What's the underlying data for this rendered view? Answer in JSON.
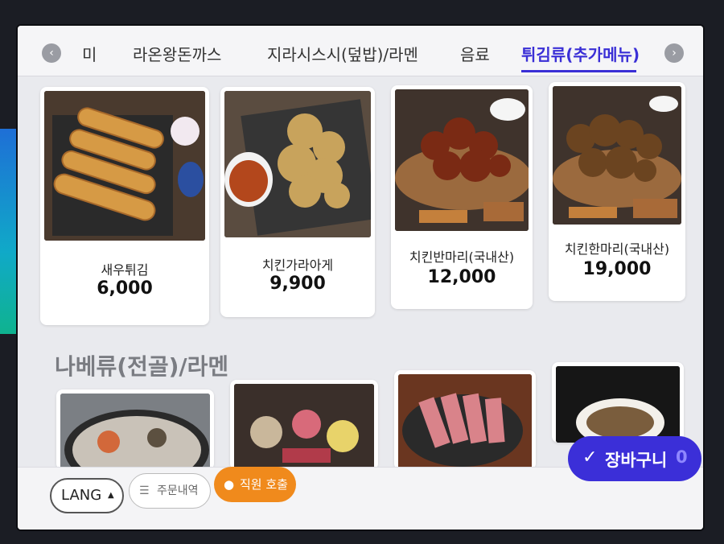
{
  "tabs": [
    {
      "label": "미",
      "active": false
    },
    {
      "label": "라온왕돈까스",
      "active": false
    },
    {
      "label": "지라시스시(덮밥)/라멘",
      "active": false
    },
    {
      "label": "음료",
      "active": false
    },
    {
      "label": "튀김류(추가메뉴)",
      "active": true
    }
  ],
  "menu_items": [
    {
      "name": "새우튀김",
      "price": "6,000"
    },
    {
      "name": "치킨가라아게",
      "price": "9,900"
    },
    {
      "name": "치킨반마리(국내산)",
      "price": "12,000"
    },
    {
      "name": "치킨한마리(국내산)",
      "price": "19,000"
    }
  ],
  "next_section": {
    "title": "나베류(전골)/라멘"
  },
  "bottom": {
    "lang_label": "LANG",
    "order_history_label": "주문내역",
    "staff_call_label": "직원 호출",
    "cart_label": "장바구니",
    "cart_count": "0"
  },
  "colors": {
    "accent": "#3b2fd8",
    "call": "#f08a1c"
  }
}
